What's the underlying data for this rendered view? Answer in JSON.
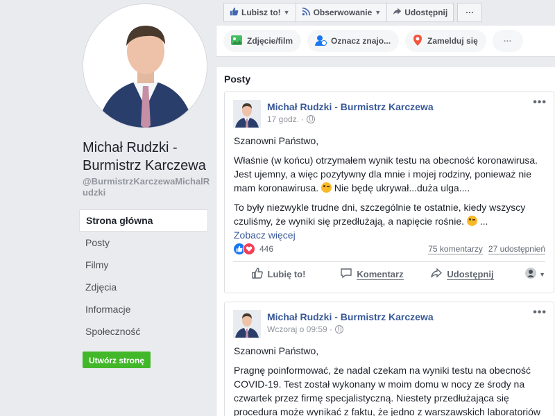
{
  "page": {
    "name": "Michał Rudzki - Burmistrz Karczewa",
    "handle": "@BurmistrzKarczewaMichalRudzki"
  },
  "left_nav": {
    "items": [
      {
        "label": "Strona główna"
      },
      {
        "label": "Posty"
      },
      {
        "label": "Filmy"
      },
      {
        "label": "Zdjęcia"
      },
      {
        "label": "Informacje"
      },
      {
        "label": "Społeczność"
      }
    ],
    "create_page_label": "Utwórz stronę"
  },
  "top_actions": {
    "like_label": "Lubisz to!",
    "follow_label": "Obserwowanie",
    "share_label": "Udostępnij",
    "more_label": "···"
  },
  "composer": {
    "photo_label": "Zdjęcie/film",
    "tag_label": "Oznacz znajo...",
    "checkin_label": "Zamelduj się",
    "more_label": "···"
  },
  "posts_section": {
    "title": "Posty"
  },
  "posts": [
    {
      "author": "Michał Rudzki - Burmistrz Karczewa",
      "time": "17 godz. ·",
      "greeting": "Szanowni Państwo,",
      "paragraph1": "Właśnie (w końcu) otrzymałem wynik testu na obecność koronawirusa. Jest ujemny, a więc pozytywny dla mnie i mojej rodziny, ponieważ nie mam koronawirusa.",
      "paragraph1_tail": " Nie będę ukrywał...duża ulga....",
      "paragraph2": "To były niezwykle trudne dni, szczególnie te ostatnie, kiedy wszyscy czuliśmy, że wyniki się przedłużają, a napięcie rośnie.",
      "paragraph2_tail": " ...",
      "see_more": "Zobacz więcej",
      "reaction_count": "446",
      "comments": "75 komentarzy",
      "shares": "27 udostępnień",
      "like_action": "Lubię to!",
      "comment_action": "Komentarz",
      "share_action": "Udostępnij"
    },
    {
      "author": "Michał Rudzki - Burmistrz Karczewa",
      "time": "Wczoraj o 09:59 ·",
      "greeting": "Szanowni Państwo,",
      "paragraph1": "Pragnę poinformować, że nadal czekam na wyniki testu na obecność COVID-19. Test został wykonany w moim domu w nocy ze środy na czwartek przez firmę specjalistyczną. Niestety przedłużająca się procedura może wynikać z faktu, że jedno z warszawskich laboratoriów"
    }
  ],
  "colors": {
    "link_blue": "#385898",
    "create_green": "#42b72a",
    "background": "#e9ebee"
  }
}
